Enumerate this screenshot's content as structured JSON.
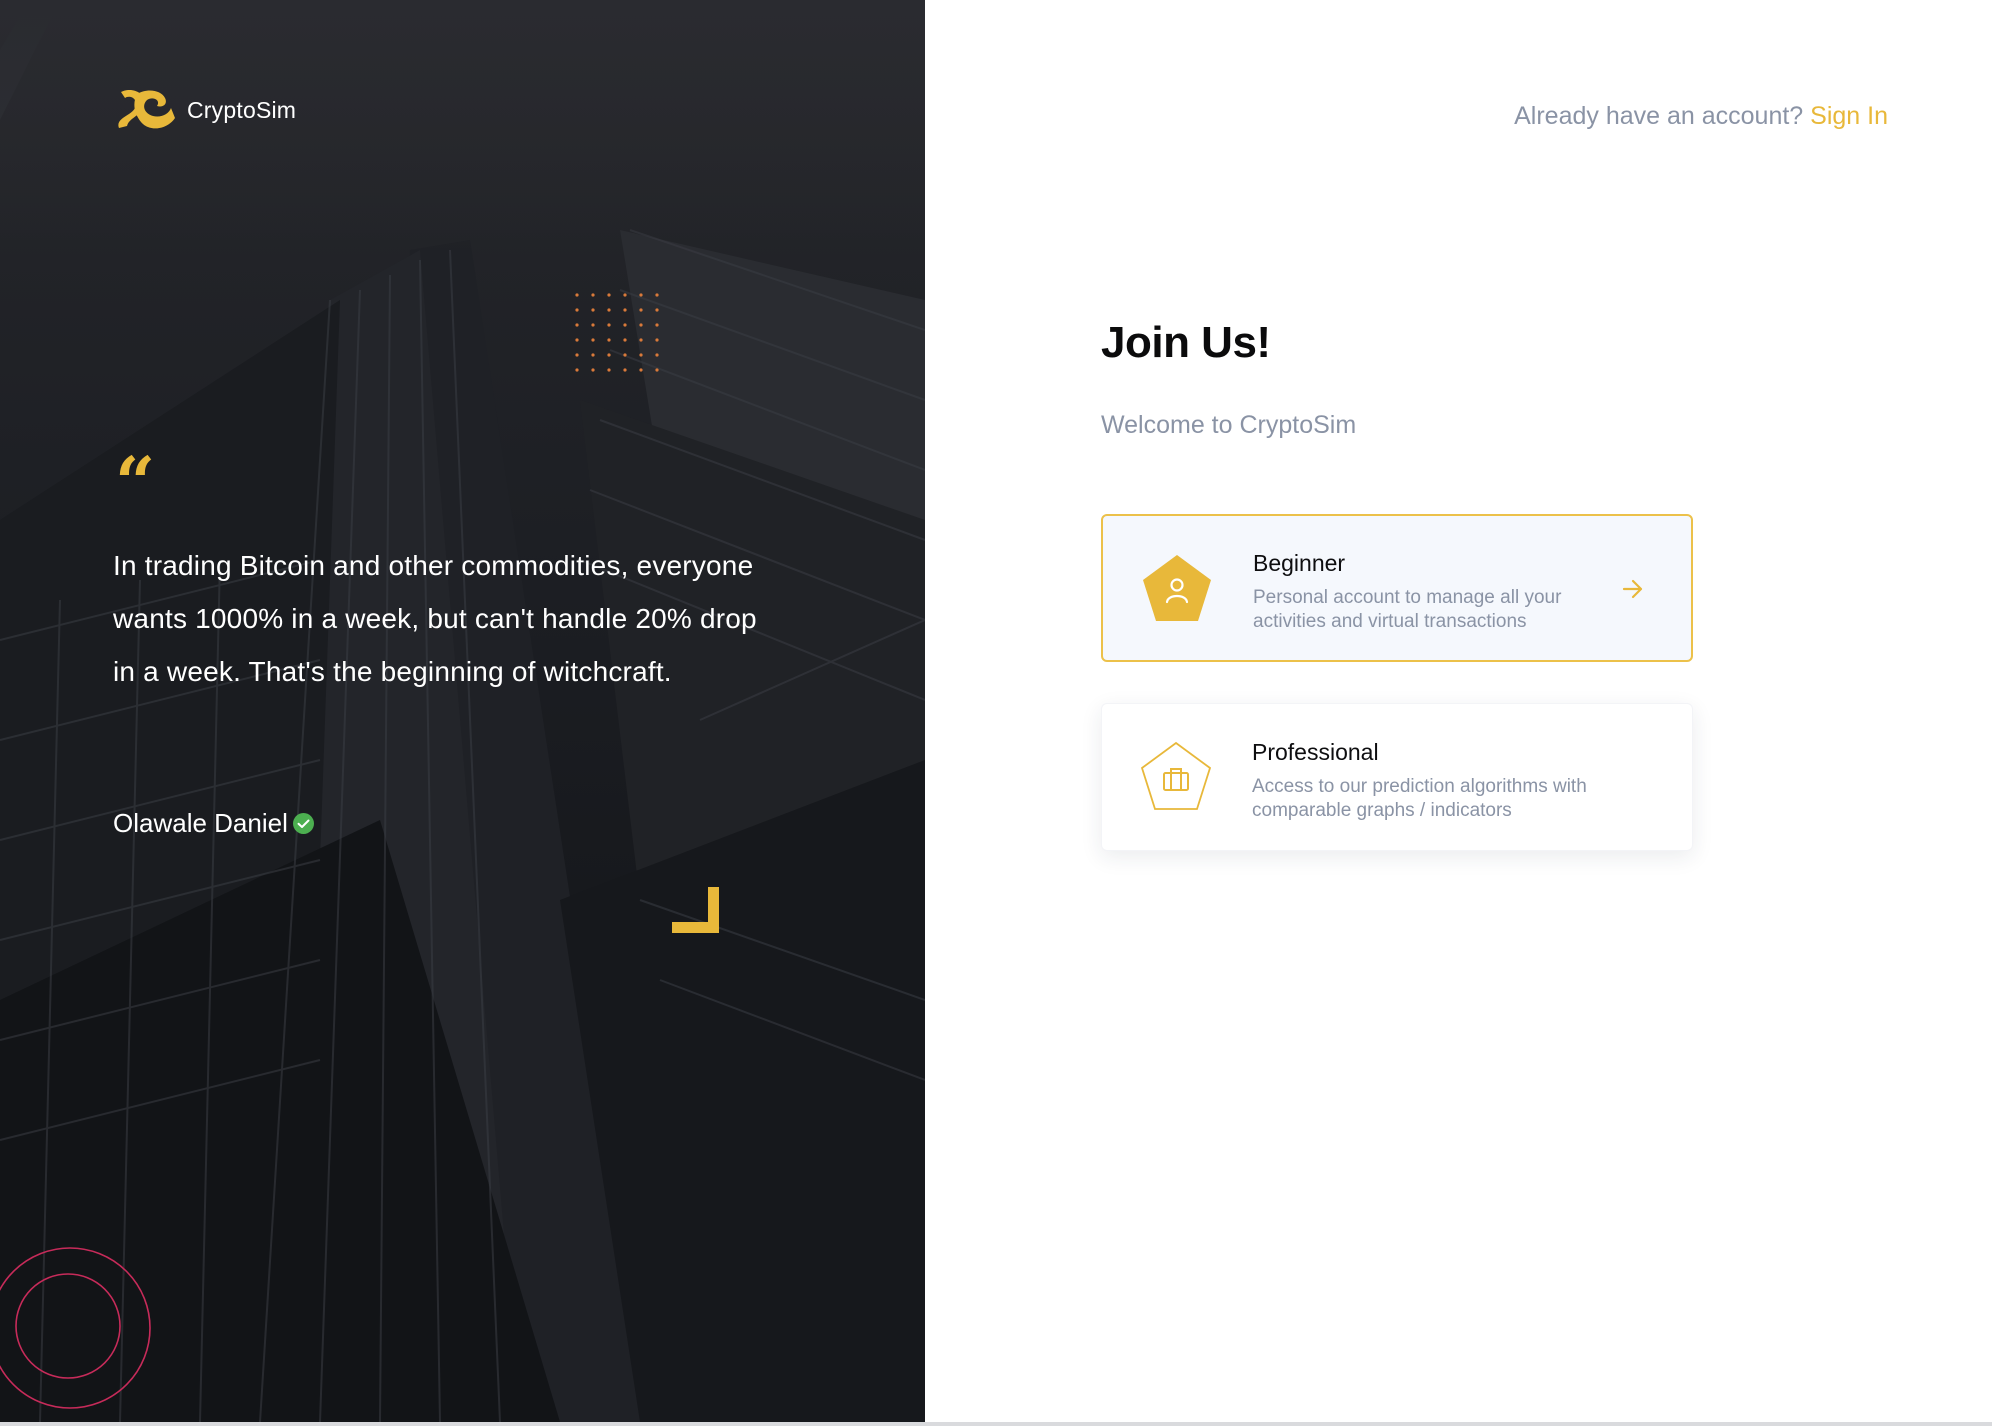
{
  "brand": {
    "name": "CryptoSim",
    "logo_icon": "cryptosim-logo-icon"
  },
  "testimonial": {
    "quote_icon": "quote-icon",
    "text": "In trading Bitcoin and other commodities, everyone wants 1000% in a week, but can't handle 20% drop in a week. That's the beginning of witchcraft.",
    "author": "Olawale Daniel",
    "verified_icon": "verified-check-icon"
  },
  "header": {
    "signin_prompt": "Already have an account?",
    "signin_link": "Sign In"
  },
  "main": {
    "title": "Join Us!",
    "subtitle": "Welcome to CryptoSim",
    "account_types": [
      {
        "title": "Beginner",
        "description": "Personal account to manage all your activities and virtual transactions",
        "icon": "user-icon",
        "selected": true,
        "arrow_icon": "arrow-right-icon"
      },
      {
        "title": "Professional",
        "description": "Access to our prediction algorithms with comparable graphs / indicators",
        "icon": "briefcase-icon",
        "selected": false
      }
    ]
  },
  "colors": {
    "accent": "#e8b83a",
    "dark_panel": "#1d1f24",
    "muted_text": "#8a93a5",
    "verified": "#4caf50",
    "decor_circle": "#c72b5a",
    "decor_dots": "#d97a3a"
  }
}
